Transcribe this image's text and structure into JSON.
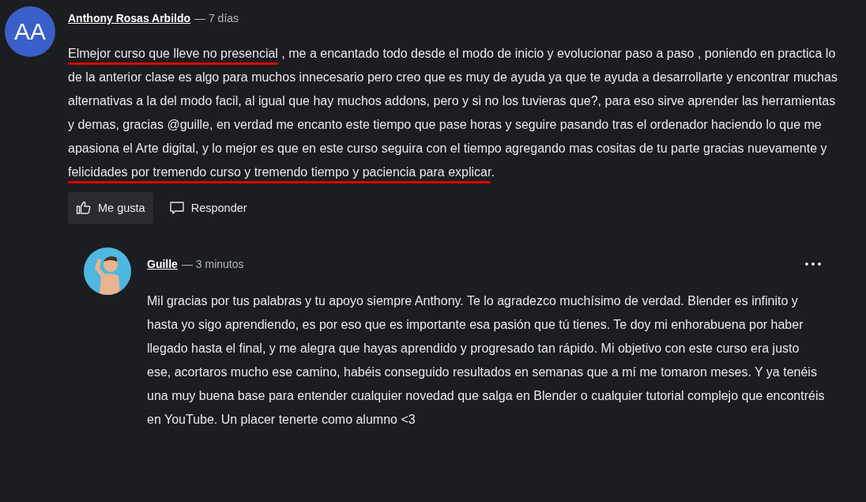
{
  "comment": {
    "avatar_initials": "AA",
    "author": "Anthony Rosas Arbildo",
    "time": "— 7 días",
    "body": [
      {
        "text": "Elmejor curso que lleve no presencial",
        "underlined": true
      },
      {
        "text": " , me a encantado todo desde el modo de inicio y evolucionar paso a paso , poniendo en practica lo de la anterior clase es algo para muchos innecesario pero creo que es muy de ayuda ya que te ayuda a desarrollarte y encontrar muchas alternativas a la del modo facil, al igual que hay muchos addons, pero y si no los tuvieras que?, para eso sirve aprender las herramientas y demas, gracias @guille, en verdad me encanto este tiempo que pase horas y seguire pasando tras el ordenador haciendo lo que me apasiona el Arte digital, y lo mejor es que en este curso seguira con el tiempo agregando mas cositas de tu parte gracias nuevamente y ",
        "underlined": false
      },
      {
        "text": "felicidades por tremendo curso y tremendo tiempo y paciencia para explicar",
        "underlined": true
      },
      {
        "text": ".",
        "underlined": false
      }
    ],
    "actions": [
      {
        "kind": "like",
        "label": "Me gusta",
        "highlighted": true
      },
      {
        "kind": "reply",
        "label": "Responder",
        "highlighted": false
      }
    ]
  },
  "reply": {
    "author": "Guille",
    "time": "— 3 minutos",
    "body": "Mil gracias por tus palabras y tu apoyo siempre Anthony. Te lo agradezco muchísimo de verdad. Blender es infinito y hasta yo sigo aprendiendo, es por eso que es importante esa pasión que tú tienes. Te doy mi enhorabuena por haber llegado hasta el final, y me alegra que hayas aprendido y progresado tan rápido. Mi objetivo con este curso era justo ese, acortaros mucho ese camino, habéis conseguido resultados en semanas que a mí me tomaron meses. Y ya tenéis una muy buena base para entender cualquier novedad que salga en Blender o cualquier tutorial complejo que encontréis en YouTube. Un placer tenerte como alumno <3"
  }
}
